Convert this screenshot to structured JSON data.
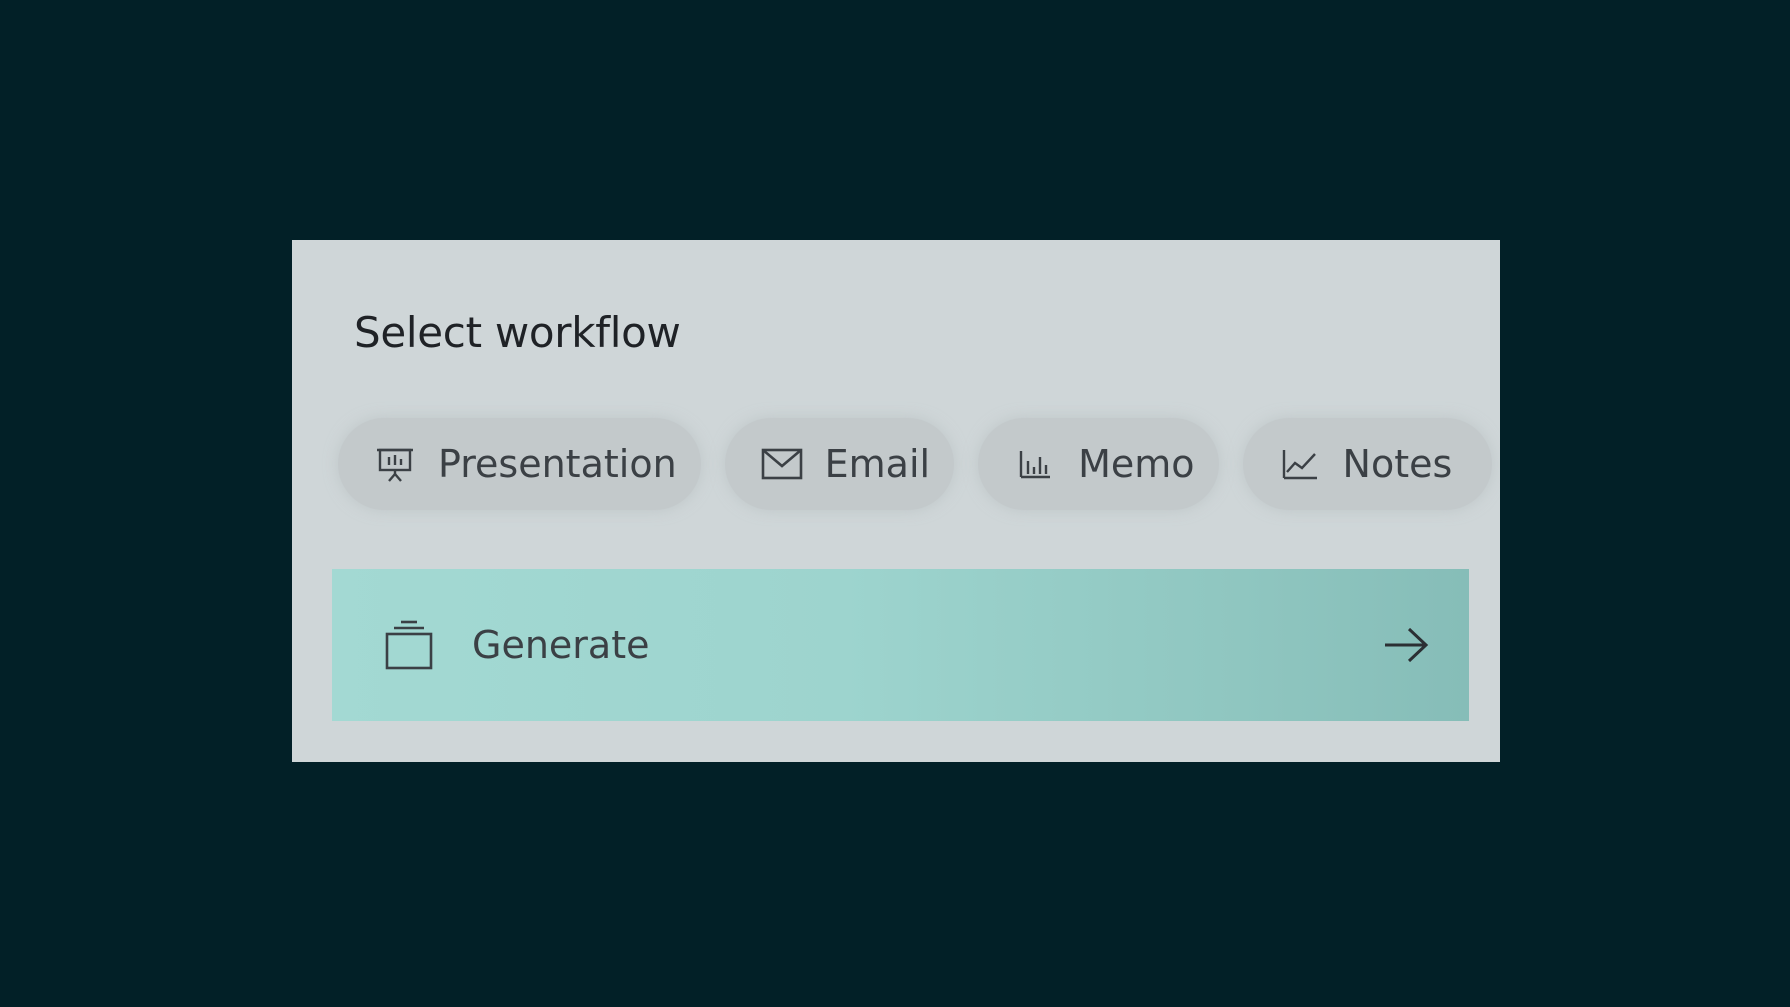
{
  "dialog": {
    "title": "Select workflow"
  },
  "workflows": [
    {
      "label": "Presentation",
      "icon": "presentation-icon"
    },
    {
      "label": "Email",
      "icon": "envelope-icon"
    },
    {
      "label": "Memo",
      "icon": "bar-chart-icon"
    },
    {
      "label": "Notes",
      "icon": "line-chart-icon"
    }
  ],
  "generate": {
    "label": "Generate",
    "icon": "stack-icon",
    "action_icon": "arrow-right-icon"
  },
  "colors": {
    "background": "#022027",
    "card": "#cfd6d8",
    "chip": "#c3c9cb",
    "accent": "#9dd4ce",
    "text": "#3b4045"
  }
}
